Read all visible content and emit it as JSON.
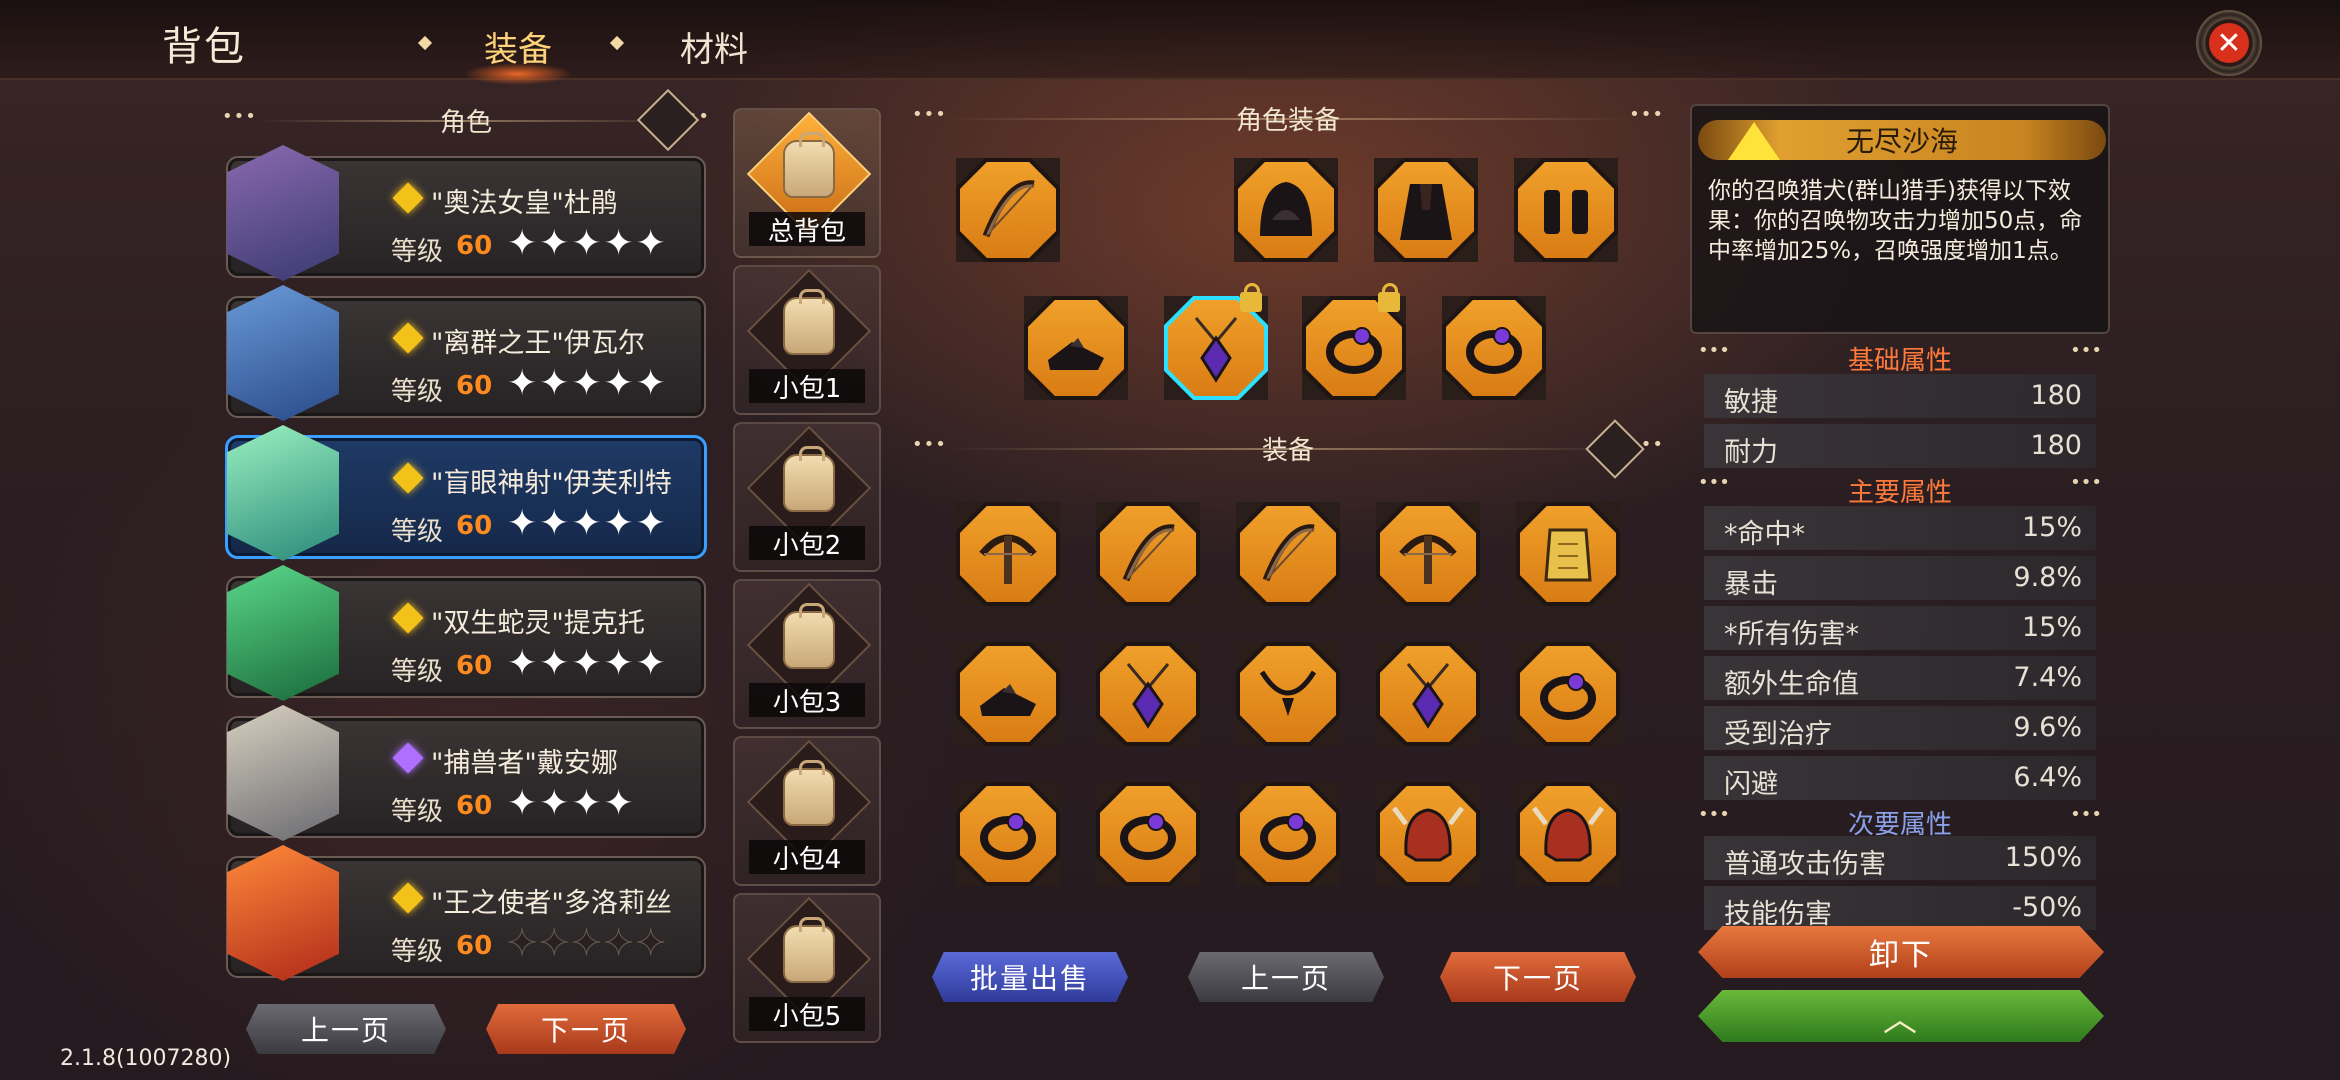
{
  "header": {
    "title": "背包",
    "tabs": [
      {
        "label": "装备",
        "active": true
      },
      {
        "label": "材料",
        "active": false
      }
    ]
  },
  "left_panel": {
    "heading": "角色",
    "characters": [
      {
        "name": "\"奥法女皇\"杜鹃",
        "level_label": "等级",
        "level": "60",
        "stars": 5,
        "rarity_color": "#f2c21a",
        "selected": false
      },
      {
        "name": "\"离群之王\"伊瓦尔",
        "level_label": "等级",
        "level": "60",
        "stars": 5,
        "rarity_color": "#f2c21a",
        "selected": false
      },
      {
        "name": "\"盲眼神射\"伊芙利特",
        "level_label": "等级",
        "level": "60",
        "stars": 5,
        "rarity_color": "#f2c21a",
        "selected": true
      },
      {
        "name": "\"双生蛇灵\"提克托",
        "level_label": "等级",
        "level": "60",
        "stars": 5,
        "rarity_color": "#f2c21a",
        "selected": false
      },
      {
        "name": "\"捕兽者\"戴安娜",
        "level_label": "等级",
        "level": "60",
        "stars": 4,
        "rarity_color": "#b070ff",
        "selected": false
      },
      {
        "name": "\"王之使者\"多洛莉丝",
        "level_label": "等级",
        "level": "60",
        "stars": 0,
        "rarity_color": "#f2c21a",
        "selected": false
      }
    ],
    "prev_label": "上一页",
    "next_label": "下一页"
  },
  "bags": [
    {
      "label": "总背包",
      "active": true
    },
    {
      "label": "小包1",
      "active": false
    },
    {
      "label": "小包2",
      "active": false
    },
    {
      "label": "小包3",
      "active": false
    },
    {
      "label": "小包4",
      "active": false
    },
    {
      "label": "小包5",
      "active": false
    }
  ],
  "equipped": {
    "heading": "角色装备",
    "slots": [
      "bow-icon",
      "empty",
      "hood-icon",
      "cloak-icon",
      "bracers-icon",
      "boots-icon",
      "amulet-icon",
      "ring-icon",
      "ring-icon"
    ]
  },
  "inventory": {
    "heading": "装备",
    "items": [
      "crossbow-icon",
      "bow-icon",
      "bow-icon",
      "crossbow-icon",
      "armor-icon",
      "boots-icon",
      "amulet-icon",
      "necklace-icon",
      "amulet-icon",
      "ring-icon",
      "ring-icon",
      "ring-icon",
      "ring-icon",
      "helmet-icon",
      "helmet-icon"
    ],
    "bulk_sell_label": "批量出售",
    "prev_label": "上一页",
    "next_label": "下一页"
  },
  "item_info": {
    "name": "无尽沙海",
    "description": "你的召唤猎犬(群山猎手)获得以下效果：你的召唤物攻击力增加50点，命中率增加25%，召唤强度增加1点。"
  },
  "attributes": {
    "basic_heading": "基础属性",
    "basic": [
      {
        "k": "敏捷",
        "v": "180"
      },
      {
        "k": "耐力",
        "v": "180"
      }
    ],
    "main_heading": "主要属性",
    "main": [
      {
        "k": "*命中*",
        "v": "15%"
      },
      {
        "k": "暴击",
        "v": "9.8%"
      },
      {
        "k": "*所有伤害*",
        "v": "15%"
      },
      {
        "k": "额外生命值",
        "v": "7.4%"
      },
      {
        "k": "受到治疗",
        "v": "9.6%"
      },
      {
        "k": "闪避",
        "v": "6.4%"
      }
    ],
    "secondary_heading": "次要属性",
    "secondary": [
      {
        "k": "普通攻击伤害",
        "v": "150%"
      },
      {
        "k": "技能伤害",
        "v": "-50%"
      }
    ]
  },
  "actions": {
    "unequip_label": "卸下"
  },
  "version": "2.1.8(1007280)",
  "colors": {
    "accent_orange": "#ff8a1e",
    "highlight_gold": "#ffd27a",
    "selected_blue": "#3aa0ff"
  }
}
